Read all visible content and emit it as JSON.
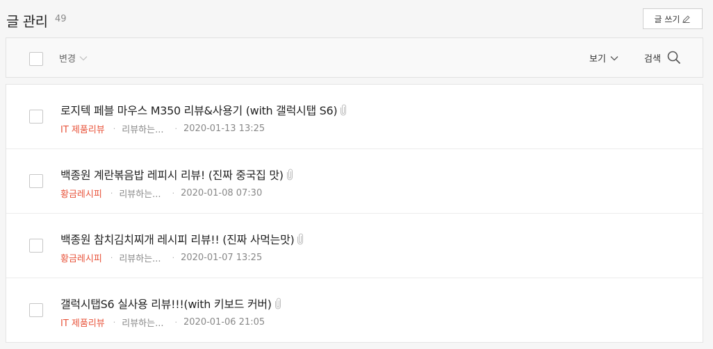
{
  "header": {
    "title": "글 관리",
    "count": "49",
    "write_label": "글 쓰기"
  },
  "toolbar": {
    "change_label": "변경",
    "view_label": "보기",
    "search_label": "검색"
  },
  "posts": [
    {
      "title": "로지텍 페블 마우스 M350 리뷰&사용기 (with 갤럭시탭 S6)",
      "category": "IT 제품리뷰",
      "status": "리뷰하는...",
      "date": "2020-01-13 13:25"
    },
    {
      "title": "백종원 계란볶음밥 레피시 리뷰! (진짜 중국집 맛)",
      "category": "황금레시피",
      "status": "리뷰하는...",
      "date": "2020-01-08 07:30"
    },
    {
      "title": "백종원 참치김치찌개 레시피 리뷰!! (진짜 사먹는맛)",
      "category": "황금레시피",
      "status": "리뷰하는...",
      "date": "2020-01-07 13:25"
    },
    {
      "title": "갤럭시탭S6 실사용 리뷰!!!(with 키보드 커버)",
      "category": "IT 제품리뷰",
      "status": "리뷰하는...",
      "date": "2020-01-06 21:05"
    }
  ],
  "colors": {
    "category": "#e8533a",
    "background": "#f6f6f6"
  },
  "icons": {
    "write": "pencil-icon",
    "change_dropdown": "chevron-down-icon",
    "view_dropdown": "chevron-down-icon",
    "search": "search-icon",
    "attachment": "paperclip-icon"
  }
}
